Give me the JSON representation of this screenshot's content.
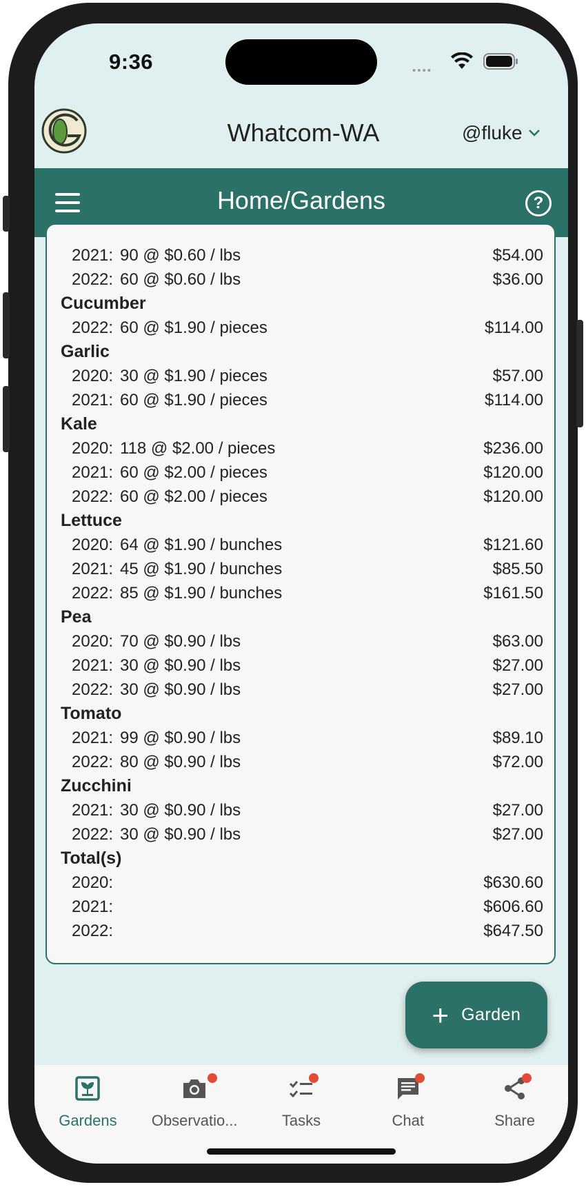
{
  "status_bar": {
    "time": "9:36"
  },
  "header": {
    "app_title": "Whatcom-WA",
    "user": "@fluke"
  },
  "toolbar": {
    "page_title": "Home/Gardens"
  },
  "crops": [
    {
      "name": "",
      "rows": [
        {
          "year": "2021:",
          "detail": "90 @ $0.60 / lbs",
          "amount": "$54.00"
        },
        {
          "year": "2022:",
          "detail": "60 @ $0.60 / lbs",
          "amount": "$36.00"
        }
      ]
    },
    {
      "name": "Cucumber",
      "rows": [
        {
          "year": "2022:",
          "detail": "60 @ $1.90 / pieces",
          "amount": "$114.00"
        }
      ]
    },
    {
      "name": "Garlic",
      "rows": [
        {
          "year": "2020:",
          "detail": "30 @ $1.90 / pieces",
          "amount": "$57.00"
        },
        {
          "year": "2021:",
          "detail": "60 @ $1.90 / pieces",
          "amount": "$114.00"
        }
      ]
    },
    {
      "name": "Kale",
      "rows": [
        {
          "year": "2020:",
          "detail": "118 @ $2.00 / pieces",
          "amount": "$236.00"
        },
        {
          "year": "2021:",
          "detail": "60 @ $2.00 / pieces",
          "amount": "$120.00"
        },
        {
          "year": "2022:",
          "detail": "60 @ $2.00 / pieces",
          "amount": "$120.00"
        }
      ]
    },
    {
      "name": "Lettuce",
      "rows": [
        {
          "year": "2020:",
          "detail": "64 @ $1.90 / bunches",
          "amount": "$121.60"
        },
        {
          "year": "2021:",
          "detail": "45 @ $1.90 / bunches",
          "amount": "$85.50"
        },
        {
          "year": "2022:",
          "detail": "85 @ $1.90 / bunches",
          "amount": "$161.50"
        }
      ]
    },
    {
      "name": "Pea",
      "rows": [
        {
          "year": "2020:",
          "detail": "70 @ $0.90 / lbs",
          "amount": "$63.00"
        },
        {
          "year": "2021:",
          "detail": "30 @ $0.90 / lbs",
          "amount": "$27.00"
        },
        {
          "year": "2022:",
          "detail": "30 @ $0.90 / lbs",
          "amount": "$27.00"
        }
      ]
    },
    {
      "name": "Tomato",
      "rows": [
        {
          "year": "2021:",
          "detail": "99 @ $0.90 / lbs",
          "amount": "$89.10"
        },
        {
          "year": "2022:",
          "detail": "80 @ $0.90 / lbs",
          "amount": "$72.00"
        }
      ]
    },
    {
      "name": "Zucchini",
      "rows": [
        {
          "year": "2021:",
          "detail": "30 @ $0.90 / lbs",
          "amount": "$27.00"
        },
        {
          "year": "2022:",
          "detail": "30 @ $0.90 / lbs",
          "amount": "$27.00"
        }
      ]
    },
    {
      "name": "Total(s)",
      "rows": [
        {
          "year": "2020:",
          "detail": "",
          "amount": "$630.60"
        },
        {
          "year": "2021:",
          "detail": "",
          "amount": "$606.60"
        },
        {
          "year": "2022:",
          "detail": "",
          "amount": "$647.50"
        }
      ]
    }
  ],
  "fab": {
    "label": "Garden",
    "icon": "plus-icon"
  },
  "bottom_nav": [
    {
      "label": "Gardens",
      "icon": "garden-icon",
      "active": true,
      "badge": false
    },
    {
      "label": "Observatio...",
      "icon": "camera-icon",
      "active": false,
      "badge": true
    },
    {
      "label": "Tasks",
      "icon": "tasks-icon",
      "active": false,
      "badge": true
    },
    {
      "label": "Chat",
      "icon": "chat-icon",
      "active": false,
      "badge": true
    },
    {
      "label": "Share",
      "icon": "share-icon",
      "active": false,
      "badge": true
    }
  ],
  "colors": {
    "primary": "#2b7168",
    "background": "#e0efef",
    "badge": "#e34b35"
  }
}
